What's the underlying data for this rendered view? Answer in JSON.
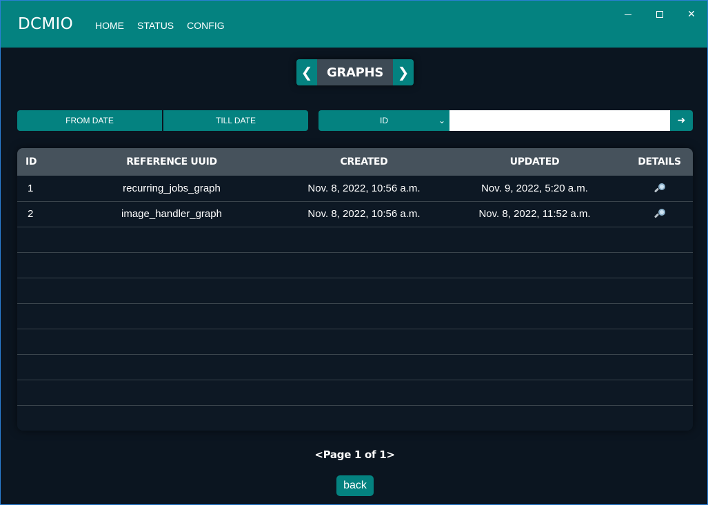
{
  "app": {
    "brand": "DCMIO",
    "nav": [
      "HOME",
      "STATUS",
      "CONFIG"
    ],
    "window_controls": [
      "minimize-icon",
      "maximize-icon",
      "close-icon"
    ]
  },
  "switcher": {
    "prev_icon": "chevron-left-icon",
    "label": "GRAPHS",
    "next_icon": "chevron-right-icon"
  },
  "filters": {
    "from_date": "FROM DATE",
    "till_date": "TILL DATE",
    "field_select": "ID",
    "search_value": "",
    "submit_icon": "arrow-right-icon"
  },
  "table": {
    "columns": [
      "ID",
      "REFERENCE UUID",
      "CREATED",
      "UPDATED",
      "DETAILS"
    ],
    "rows": [
      {
        "id": "1",
        "reference_uuid": "recurring_jobs_graph",
        "created": "Nov. 8, 2022, 10:56 a.m.",
        "updated": "Nov. 9, 2022, 5:20 a.m.",
        "details_icon": "magnifier-icon"
      },
      {
        "id": "2",
        "reference_uuid": "image_handler_graph",
        "created": "Nov. 8, 2022, 10:56 a.m.",
        "updated": "Nov. 8, 2022, 11:52 a.m.",
        "details_icon": "magnifier-icon"
      }
    ],
    "empty_rows": 8
  },
  "pager": {
    "text": "<Page 1 of 1>"
  },
  "back_label": "back",
  "colors": {
    "accent": "#048280",
    "background": "#0b1520",
    "header": "#46525c"
  }
}
